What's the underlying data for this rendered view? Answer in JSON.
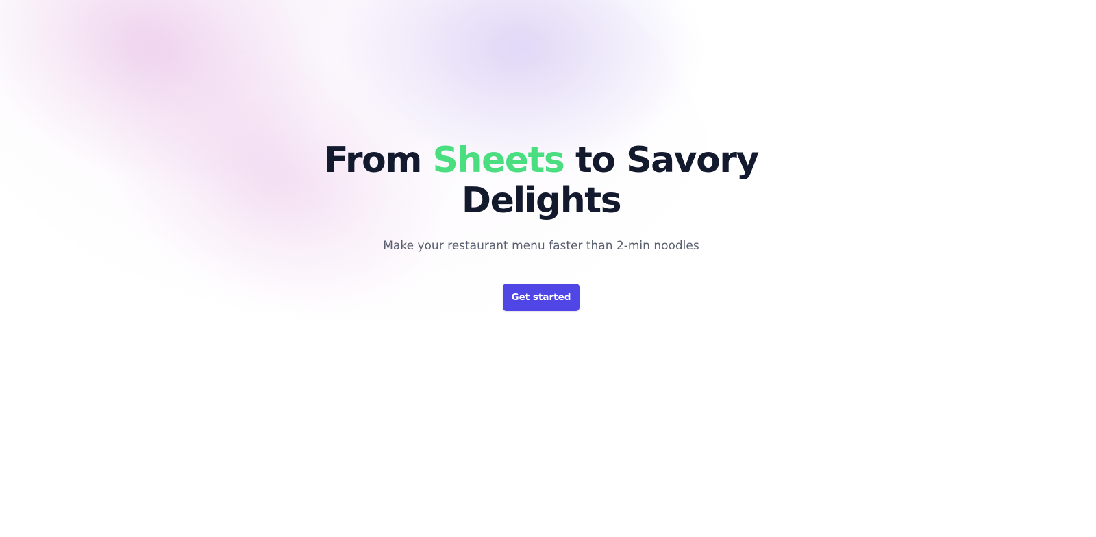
{
  "hero": {
    "title_before": "From ",
    "title_accent": "Sheets",
    "title_after": " to Savory Delights",
    "subtitle": "Make your restaurant menu faster than 2-min noodles",
    "cta_label": "Get started"
  },
  "colors": {
    "title": "#141a2e",
    "accent": "#4ade80",
    "subtitle": "#5a6070",
    "cta_background": "#4f46e5",
    "cta_text": "#ffffff"
  }
}
